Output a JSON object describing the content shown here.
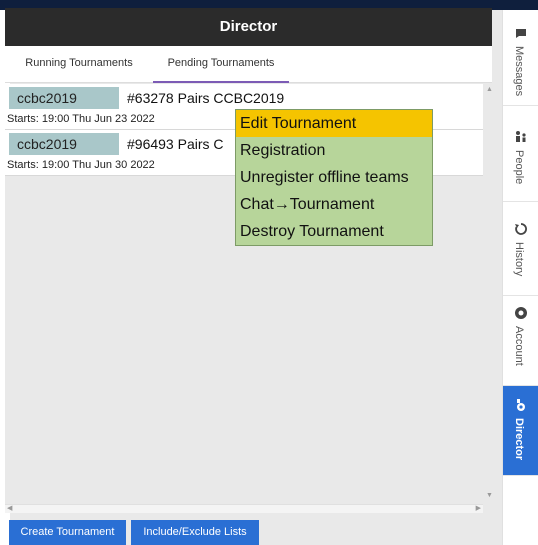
{
  "window": {
    "title": "Director"
  },
  "tabs": [
    {
      "label": "Running Tournaments"
    },
    {
      "label": "Pending Tournaments"
    }
  ],
  "tournaments": [
    {
      "club": "ccbc2019",
      "name": "#63278 Pairs CCBC2019",
      "starts": "Starts: 19:00 Thu Jun 23 2022"
    },
    {
      "club": "ccbc2019",
      "name": "#96493 Pairs C",
      "starts": "Starts: 19:00 Thu Jun 30 2022"
    }
  ],
  "context_menu": {
    "items": [
      {
        "label": "Edit Tournament"
      },
      {
        "label": "Registration"
      },
      {
        "label": "Unregister offline teams"
      },
      {
        "label": "Chat→Tournament"
      },
      {
        "label": "Destroy Tournament"
      }
    ],
    "selected_index": 0
  },
  "buttons": {
    "create": "Create Tournament",
    "include_exclude": "Include/Exclude Lists"
  },
  "sidebar": {
    "items": [
      {
        "label": "Messages",
        "icon": "messages-icon"
      },
      {
        "label": "People",
        "icon": "people-icon"
      },
      {
        "label": "History",
        "icon": "history-icon"
      },
      {
        "label": "Account",
        "icon": "account-icon"
      },
      {
        "label": "Director",
        "icon": "director-icon",
        "active": true
      }
    ]
  },
  "colors": {
    "accent": "#2a6fd4",
    "menu_bg": "#b7d59a",
    "menu_selected": "#f5c400",
    "club_pill": "#a9c7c9",
    "tab_underline": "#7c5bb5"
  }
}
